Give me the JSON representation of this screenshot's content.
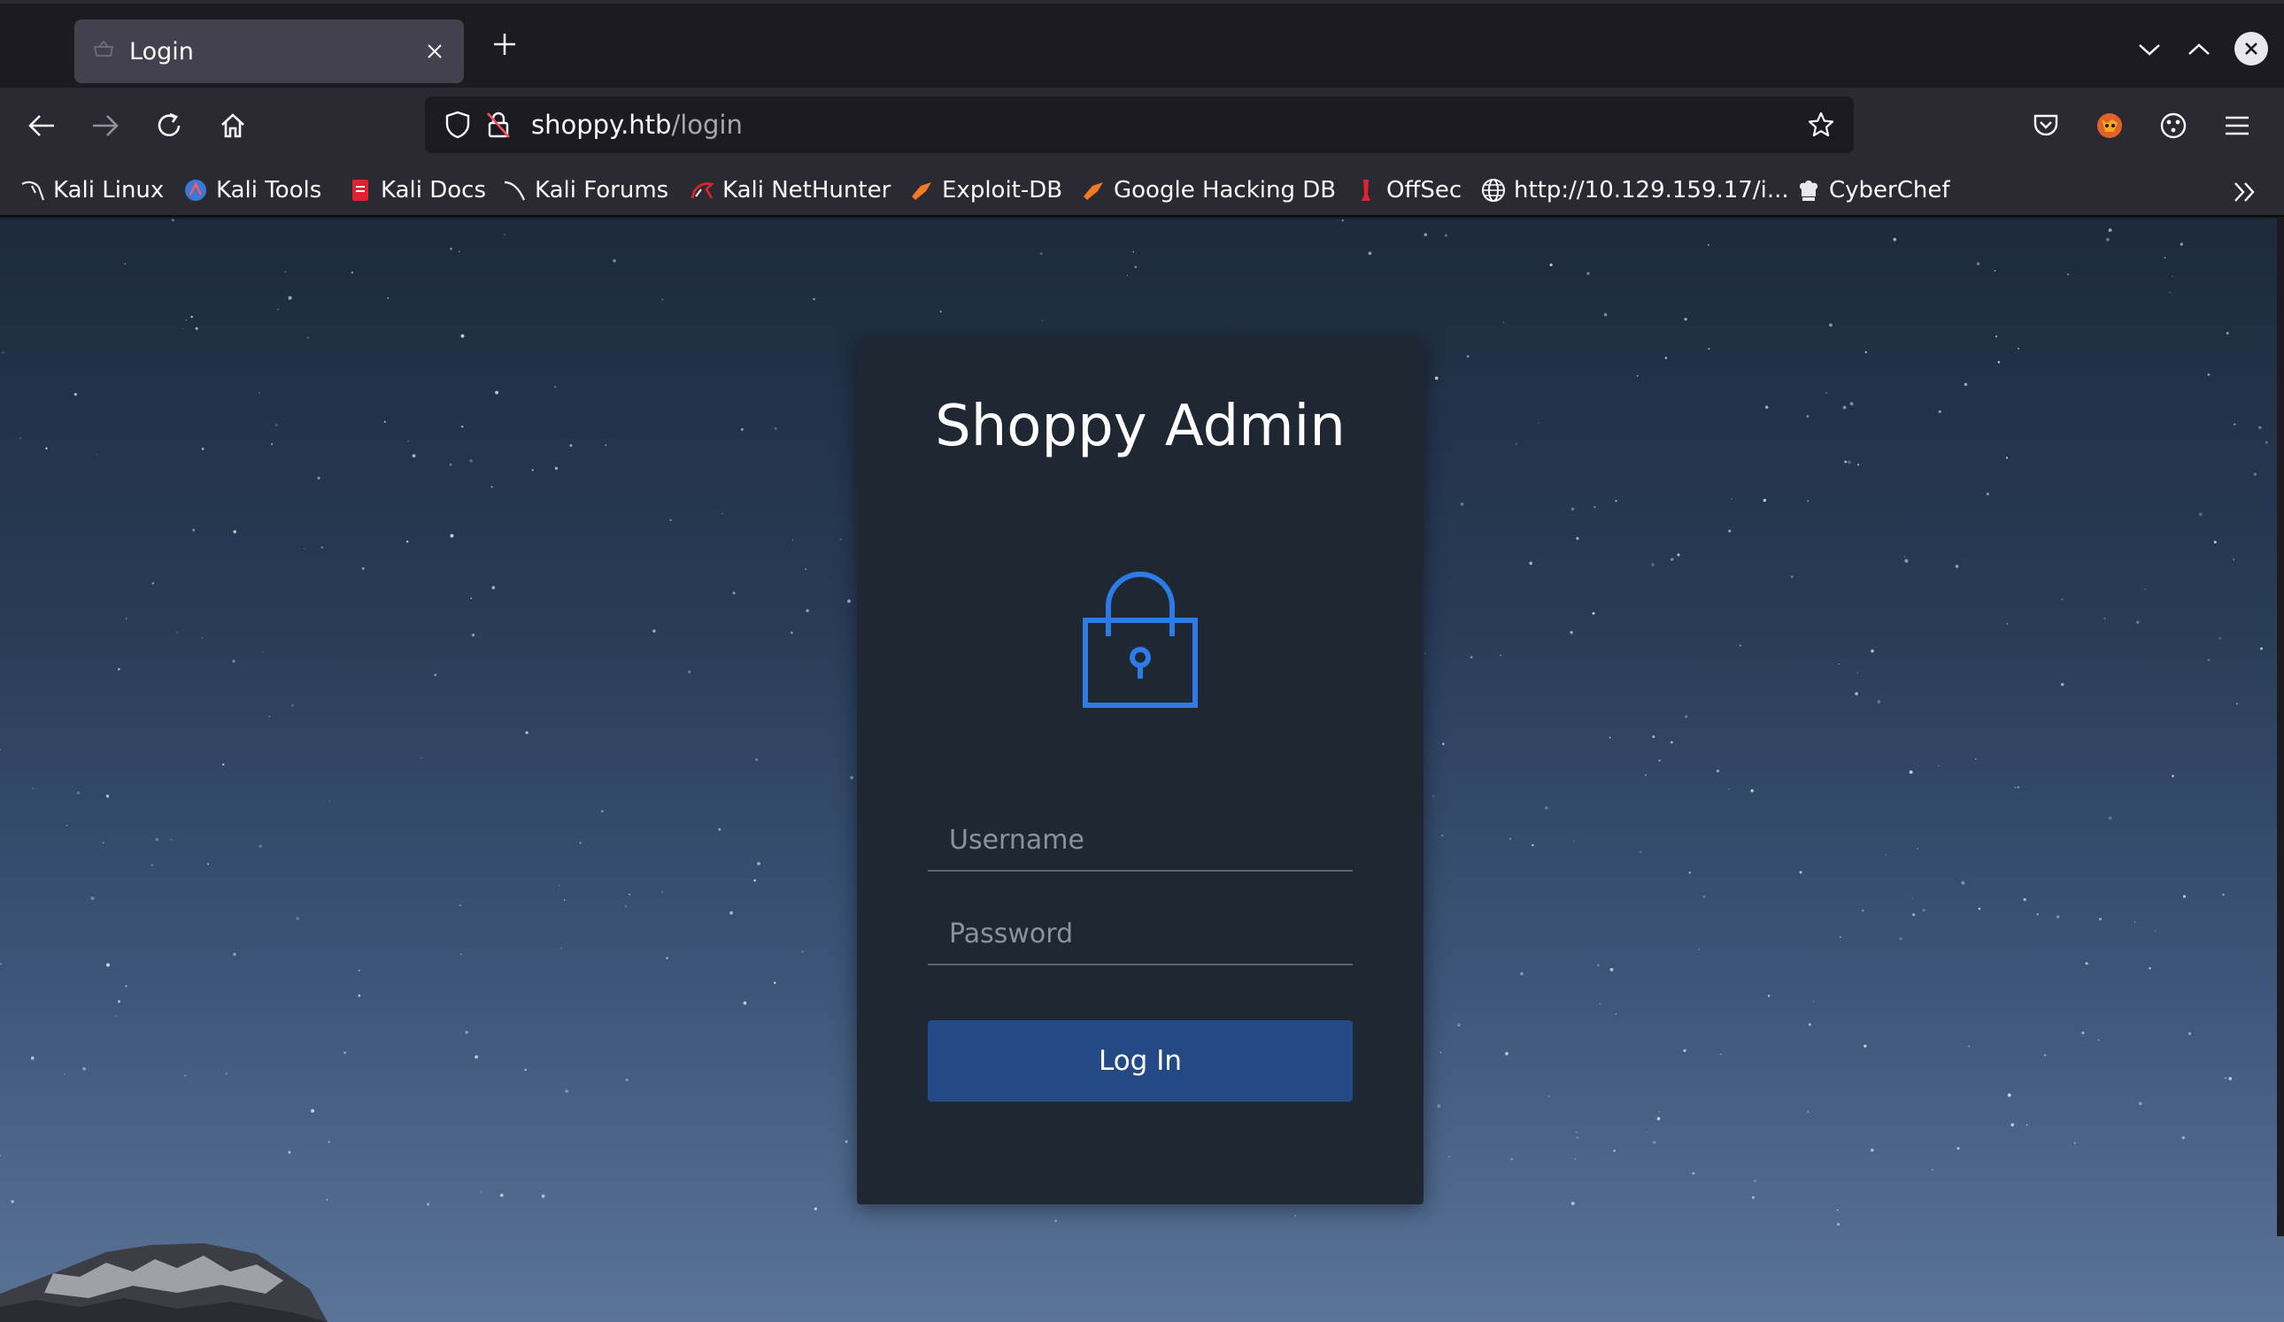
{
  "browser": {
    "tab": {
      "title": "Login"
    },
    "address": {
      "host": "shoppy.htb",
      "path": "/login"
    },
    "bookmarks": [
      {
        "label": "Kali Linux",
        "icon": "kali-dragon-icon"
      },
      {
        "label": "Kali Tools",
        "icon": "kali-tools-icon"
      },
      {
        "label": "Kali Docs",
        "icon": "kali-docs-icon"
      },
      {
        "label": "Kali Forums",
        "icon": "kali-forums-icon"
      },
      {
        "label": "Kali NetHunter",
        "icon": "kali-nethunter-icon"
      },
      {
        "label": "Exploit-DB",
        "icon": "exploit-db-icon"
      },
      {
        "label": "Google Hacking DB",
        "icon": "ghdb-icon"
      },
      {
        "label": "OffSec",
        "icon": "offsec-icon"
      },
      {
        "label": "http://10.129.159.17/i...",
        "icon": "globe-icon"
      },
      {
        "label": "CyberChef",
        "icon": "cyberchef-icon"
      }
    ]
  },
  "login": {
    "heading": "Shoppy Admin",
    "username_placeholder": "Username",
    "password_placeholder": "Password",
    "button_label": "Log In"
  },
  "colors": {
    "card_bg": "#1f2733",
    "accent_blue": "#2d7be5",
    "button_bg": "#234a84"
  }
}
